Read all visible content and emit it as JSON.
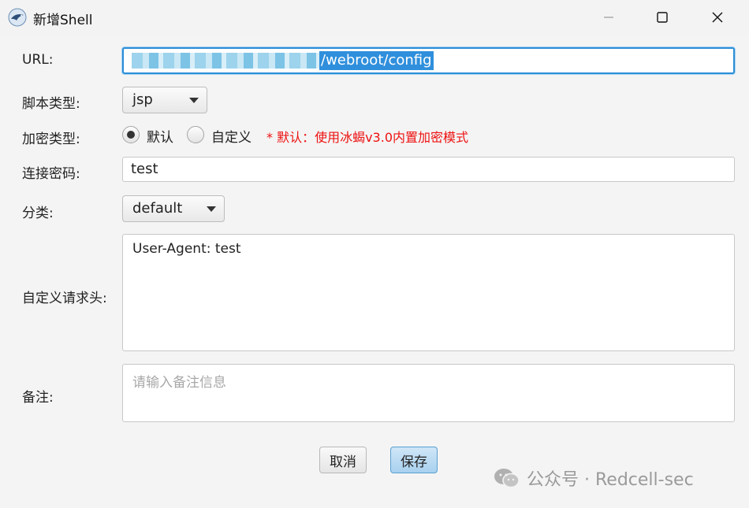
{
  "window": {
    "title": "新增Shell",
    "app_icon": "bird-logo-icon"
  },
  "form": {
    "url": {
      "label": "URL:",
      "value_selected": "/webroot/config"
    },
    "script_type": {
      "label": "脚本类型:",
      "selected": "jsp"
    },
    "encryption": {
      "label": "加密类型:",
      "options": [
        "默认",
        "自定义"
      ],
      "selected": "默认",
      "hint": "* 默认：使用冰蝎v3.0内置加密模式"
    },
    "password": {
      "label": "连接密码:",
      "value": "test"
    },
    "category": {
      "label": "分类:",
      "selected": "default"
    },
    "headers": {
      "label": "自定义请求头:",
      "value": "User-Agent: test"
    },
    "remark": {
      "label": "备注:",
      "placeholder": "请输入备注信息"
    }
  },
  "buttons": {
    "cancel": "取消",
    "save": "保存"
  },
  "watermark": {
    "text": "公众号 · Redcell-sec"
  },
  "colors": {
    "accent": "#2c8ed6",
    "hint": "#e11111",
    "save_button": "#a8d1ef"
  }
}
